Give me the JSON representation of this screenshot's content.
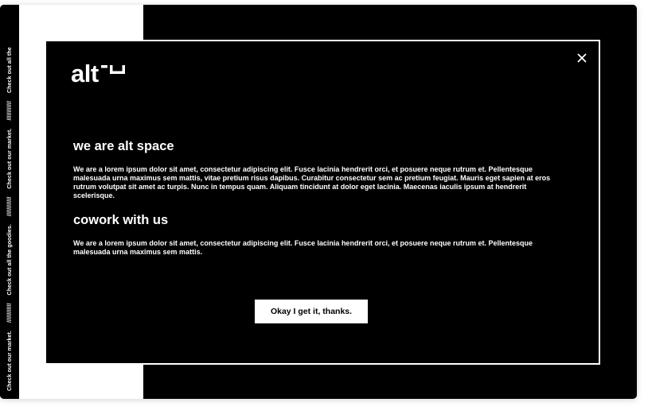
{
  "side_banner": {
    "items": [
      "Check out our market.",
      "////////////",
      "Check out all the goodies.",
      "////////////",
      "Check out our market.",
      "////////////",
      "Check out all the"
    ]
  },
  "modal": {
    "logo_text": "alt",
    "close_icon": "close-icon",
    "sections": [
      {
        "heading": "we are alt space",
        "text": "We are a lorem ipsum dolor sit amet, consectetur adipiscing elit. Fusce lacinia hendrerit orci, et posuere neque rutrum et. Pellentesque malesuada urna maximus sem mattis, vitae pretium risus dapibus. Curabitur consectetur sem ac pretium feugiat. Mauris eget sapien at eros rutrum volutpat sit amet ac turpis. Nunc in tempus quam. Aliquam tincidunt at dolor eget lacinia. Maecenas iaculis ipsum at hendrerit scelerisque."
      },
      {
        "heading": "cowork with us",
        "text": "We are a lorem ipsum dolor sit amet, consectetur adipiscing elit. Fusce lacinia hendrerit orci, et posuere neque rutrum et. Pellentesque malesuada urna maximus sem mattis."
      }
    ],
    "button_label": "Okay I get it, thanks."
  },
  "colors": {
    "background": "#000000",
    "foreground": "#ffffff"
  }
}
